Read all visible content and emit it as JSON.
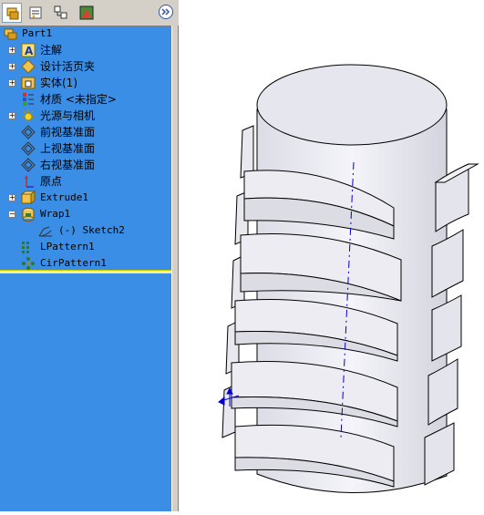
{
  "toolbar": {
    "tabs": [
      {
        "icon": "feature-manager-icon"
      },
      {
        "icon": "property-manager-icon"
      },
      {
        "icon": "configuration-manager-icon"
      },
      {
        "icon": "display-manager-icon"
      }
    ],
    "expand_icon": "double-chevron-right-icon"
  },
  "tree": {
    "root": "Part1",
    "items": [
      {
        "label": "注解",
        "icon": "annotations-icon",
        "expandable": true
      },
      {
        "label": "设计活页夹",
        "icon": "design-binder-icon",
        "expandable": true
      },
      {
        "label": "实体(1)",
        "icon": "solid-bodies-icon",
        "expandable": true
      },
      {
        "label": "材质 <未指定>",
        "icon": "material-icon",
        "expandable": false
      },
      {
        "label": "光源与相机",
        "icon": "lights-cameras-icon",
        "expandable": true
      },
      {
        "label": "前视基准面",
        "icon": "plane-icon",
        "expandable": false
      },
      {
        "label": "上视基准面",
        "icon": "plane-icon",
        "expandable": false
      },
      {
        "label": "右视基准面",
        "icon": "plane-icon",
        "expandable": false
      },
      {
        "label": "原点",
        "icon": "origin-icon",
        "expandable": false
      },
      {
        "label": "Extrude1",
        "icon": "extrude-icon",
        "expandable": true
      },
      {
        "label": "Wrap1",
        "icon": "wrap-icon",
        "expandable": true,
        "expanded": true
      },
      {
        "label": "(-) Sketch2",
        "icon": "sketch-icon",
        "expandable": false,
        "child": true
      },
      {
        "label": "LPattern1",
        "icon": "linear-pattern-icon",
        "expandable": false
      },
      {
        "label": "CirPattern1",
        "icon": "circular-pattern-icon",
        "expandable": false
      }
    ]
  },
  "colors": {
    "panel_bg": "#3a8ee6",
    "part_face": "#e6e6ee",
    "part_edge": "#000000",
    "axis": "#0000cc"
  }
}
